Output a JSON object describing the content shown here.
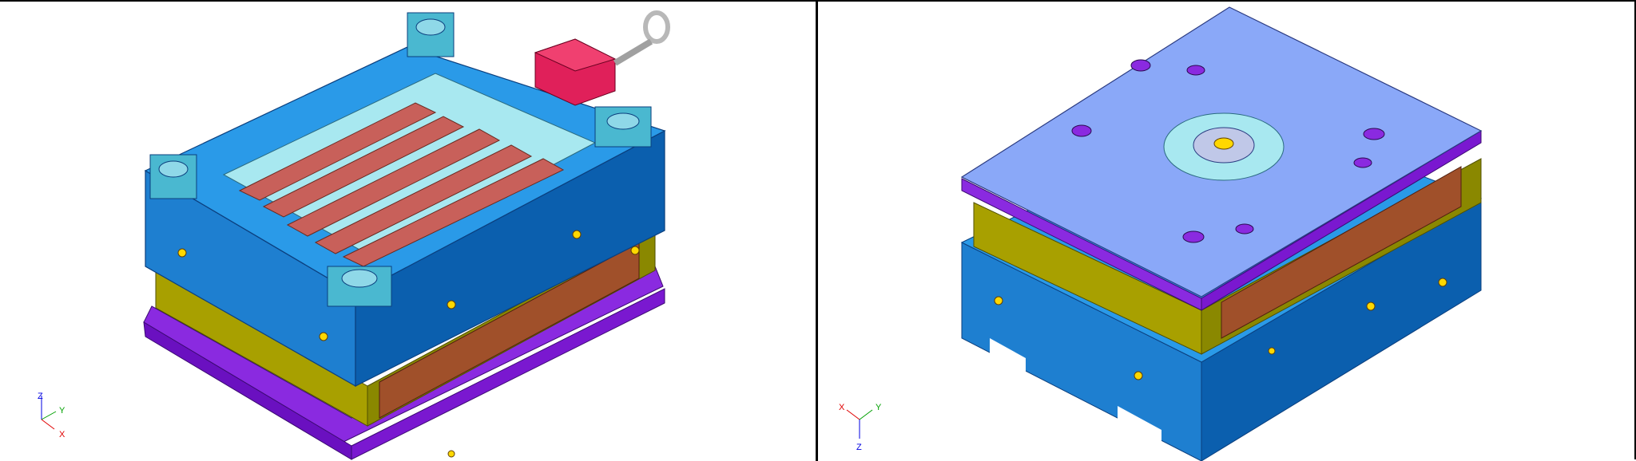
{
  "viewports": [
    {
      "name": "left",
      "triad": {
        "z": "Z",
        "y": "Y",
        "x": "X"
      }
    },
    {
      "name": "right",
      "triad": {
        "x": "X",
        "y": "Y",
        "z": "Z"
      }
    }
  ],
  "colors": {
    "mold_blue": "#1e7fd0",
    "mold_dark_blue": "#0b4f8e",
    "cavity_cyan": "#a8e8f0",
    "part_red": "#c8605a",
    "plate_olive": "#a8a000",
    "plate_purple": "#8a2ae0",
    "lift_red": "#e0205a",
    "plate_lavender": "#8aa8f8",
    "insulation_brown": "#a0502a",
    "axis_x": "#e00000",
    "axis_y": "#00a000",
    "axis_z": "#0000e0"
  },
  "icons": [
    "lifting-eye-icon",
    "coordinate-triad-icon"
  ]
}
